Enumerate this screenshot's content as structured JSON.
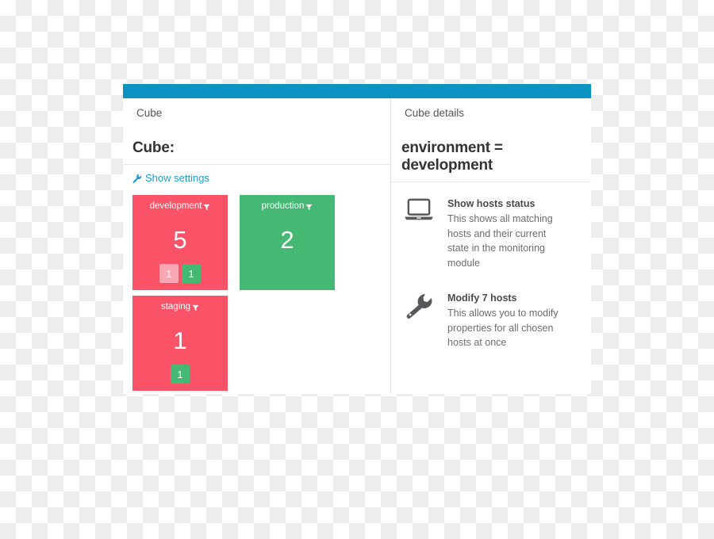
{
  "window": {
    "accent_color": "#0b93c1",
    "left": {
      "tab_label": "Cube",
      "refresh_icon": "refresh-icon",
      "close_icon": "close-icon",
      "title": "Cube:",
      "settings_link": "Show settings",
      "settings_icon": "wrench-icon"
    },
    "right": {
      "tab_label": "Cube details",
      "refresh_icon": "refresh-icon",
      "title": "environment = development"
    }
  },
  "tiles": [
    {
      "label": "development",
      "count": "5",
      "color": "#fa5368",
      "state": "red",
      "filter_icon": "funnel-icon",
      "badges": [
        {
          "value": "1",
          "tone": "pink",
          "color": "#f9a7b3"
        },
        {
          "value": "1",
          "tone": "green",
          "color": "#45b873"
        }
      ]
    },
    {
      "label": "production",
      "count": "2",
      "color": "#45b873",
      "state": "green",
      "filter_icon": "funnel-icon",
      "badges": []
    },
    {
      "label": "staging",
      "count": "1",
      "color": "#fa5368",
      "state": "red",
      "filter_icon": "funnel-icon",
      "badges": [
        {
          "value": "1",
          "tone": "green",
          "color": "#45b873"
        }
      ]
    }
  ],
  "actions": [
    {
      "icon": "laptop-icon",
      "title": "Show hosts status",
      "description": "This shows all matching hosts and their current state in the monitoring module"
    },
    {
      "icon": "wrench-icon",
      "title": "Modify 7 hosts",
      "description": "This allows you to modify properties for all chosen hosts at once"
    }
  ]
}
